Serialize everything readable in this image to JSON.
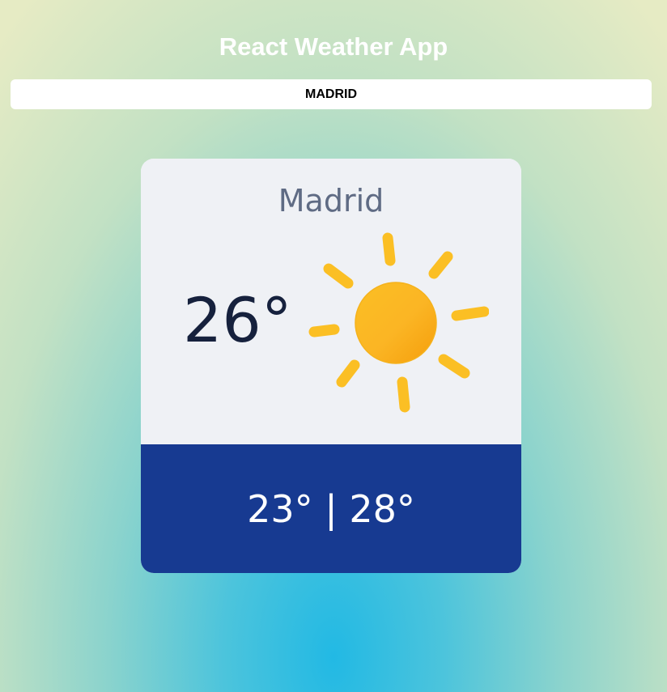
{
  "app": {
    "title": "React Weather App"
  },
  "search": {
    "value": "MADRID"
  },
  "weather": {
    "city": "Madrid",
    "current_temp": "26°",
    "condition_icon": "sun-icon",
    "temp_range": "23° | 28°"
  },
  "colors": {
    "card_top": "#eff1f5",
    "card_bottom": "#173a91",
    "sun": "#fbbf24"
  }
}
